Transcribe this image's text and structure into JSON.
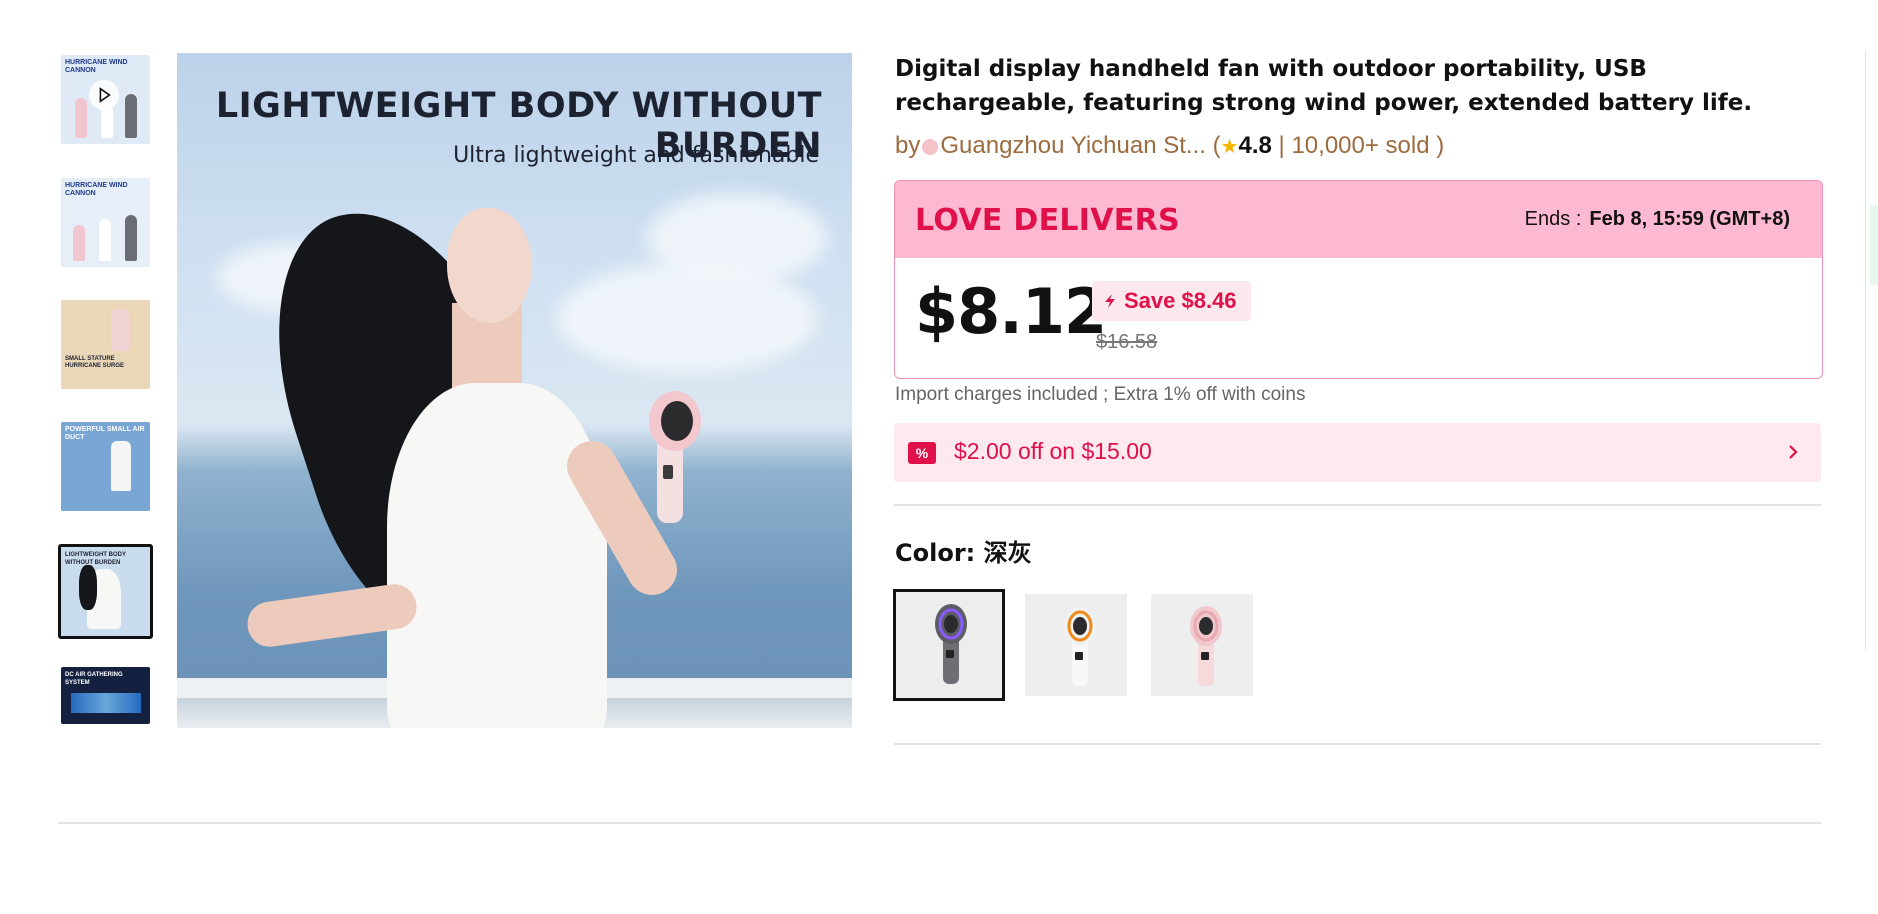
{
  "thumbnails": [
    {
      "label": "HURRICANE WIND CANNON",
      "has_video": true,
      "bg": "#dfeaf6"
    },
    {
      "label": "HURRICANE WIND CANNON",
      "has_video": false,
      "bg": "#e6eef8"
    },
    {
      "label": "SMALL STATURE HURRICANE SURGE",
      "has_video": false,
      "bg": "#e9d7b8"
    },
    {
      "label": "POWERFUL SMALL AIR DUCT",
      "has_video": false,
      "bg": "#7aa6d6"
    },
    {
      "label": "LIGHTWEIGHT BODY WITHOUT BURDEN",
      "has_video": false,
      "bg": "#c9dcee",
      "selected": true
    },
    {
      "label": "DC AIR GATHERING SYSTEM",
      "has_video": false,
      "bg": "#13203f"
    }
  ],
  "main_image": {
    "headline": "LIGHTWEIGHT BODY WITHOUT BURDEN",
    "subline": "Ultra lightweight and fashionable"
  },
  "product": {
    "title": "Digital display handheld fan with outdoor portability, USB rechargeable, featuring strong wind power, extended battery life.",
    "by": "by",
    "seller": "Guangzhou Yichuan St...",
    "open_paren": "(",
    "star_icon": "star-icon",
    "rating": "4.8",
    "sold": "| 10,000+ sold )"
  },
  "deal": {
    "name": "LOVE DELIVERS",
    "ends_label": "Ends :",
    "ends_value": "Feb 8, 15:59 (GMT+8)",
    "price": "$8.12",
    "save": "Save $8.46",
    "original_price": "$16.58"
  },
  "import_note": "Import charges included ; Extra 1% off with coins",
  "coupon": {
    "icon_text": "%",
    "text": "$2.00 off on $15.00"
  },
  "color": {
    "label": "Color:",
    "selected": "深灰",
    "options": [
      {
        "name": "dark-gray",
        "body": "#6d6f75",
        "ring": "#8a5cff"
      },
      {
        "name": "white",
        "body": "#f4f4f4",
        "ring": "#f08a1c"
      },
      {
        "name": "pink",
        "body": "#f3d4d6",
        "ring": "#333333"
      }
    ]
  },
  "colors": {
    "accent_red": "#e0104a",
    "deal_pink": "#fdb9d1",
    "seller_brown": "#9c6b3e"
  }
}
